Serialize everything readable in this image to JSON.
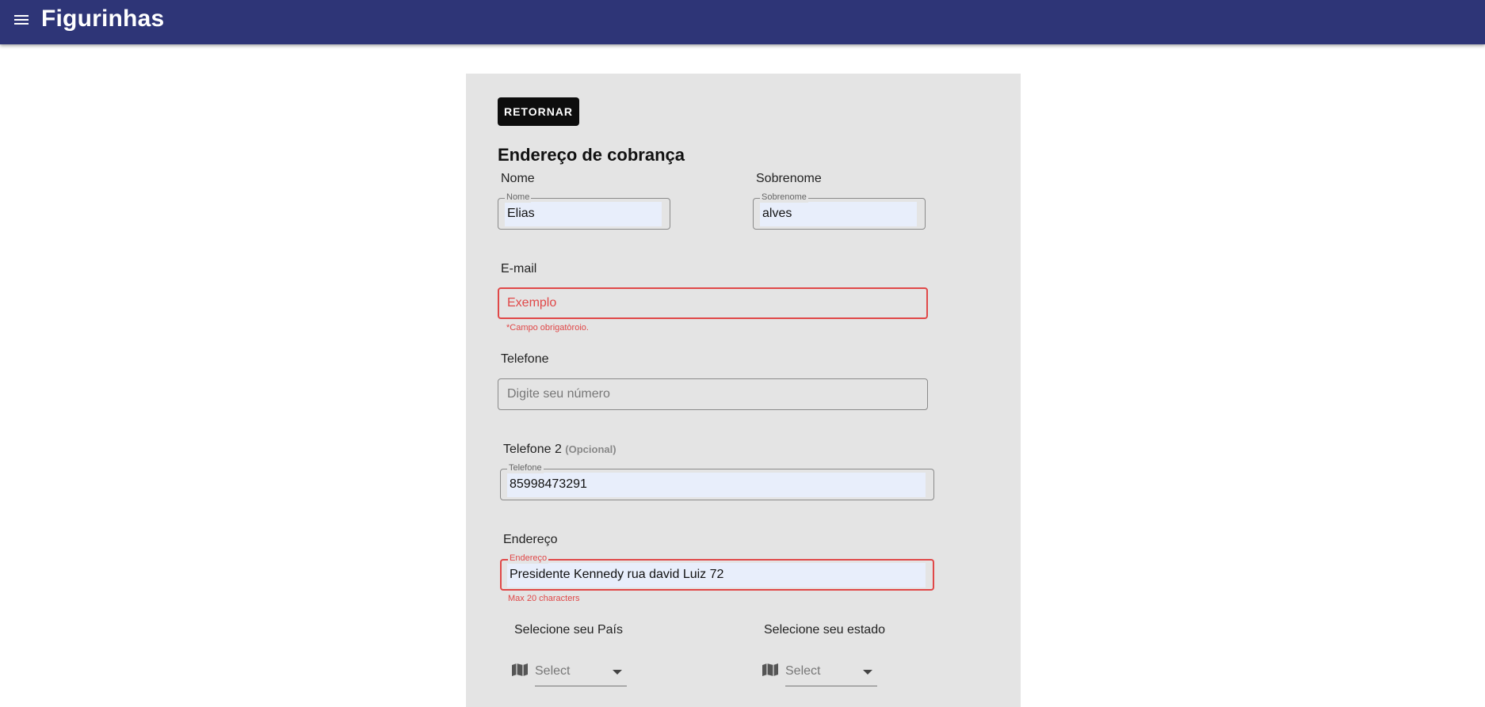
{
  "appbar": {
    "title": "Figurinhas",
    "menu_icon": "menu-icon"
  },
  "form": {
    "back_label": "RETORNAR",
    "title": "Endereço de cobrança",
    "nome": {
      "label": "Nome",
      "legend": "Nome",
      "value": "Elias"
    },
    "sobrenome": {
      "label": "Sobrenome",
      "legend": "Sobrenome",
      "value": "alves"
    },
    "email": {
      "label": "E-mail",
      "placeholder": "Exemplo",
      "error": "*Campo obrigatòroio."
    },
    "telefone": {
      "label": "Telefone",
      "placeholder": "Digite seu número"
    },
    "telefone2": {
      "label": "Telefone 2",
      "optional": "(Opcional)",
      "legend": "Telefone",
      "value": "85998473291"
    },
    "endereco": {
      "label": "Endereço",
      "legend": "Endereço",
      "value": "Presidente Kennedy rua david Luiz 72",
      "error": "Max 20 characters"
    },
    "pais": {
      "label": "Selecione seu País",
      "selected": "Select",
      "icon": "map-icon"
    },
    "estado": {
      "label": "Selecione seu estado",
      "selected": "Select",
      "icon": "map-icon"
    }
  },
  "colors": {
    "appbar": "#2e3577",
    "card": "#e4e4e4",
    "error": "#e04848",
    "autofill": "#e8eefb"
  }
}
